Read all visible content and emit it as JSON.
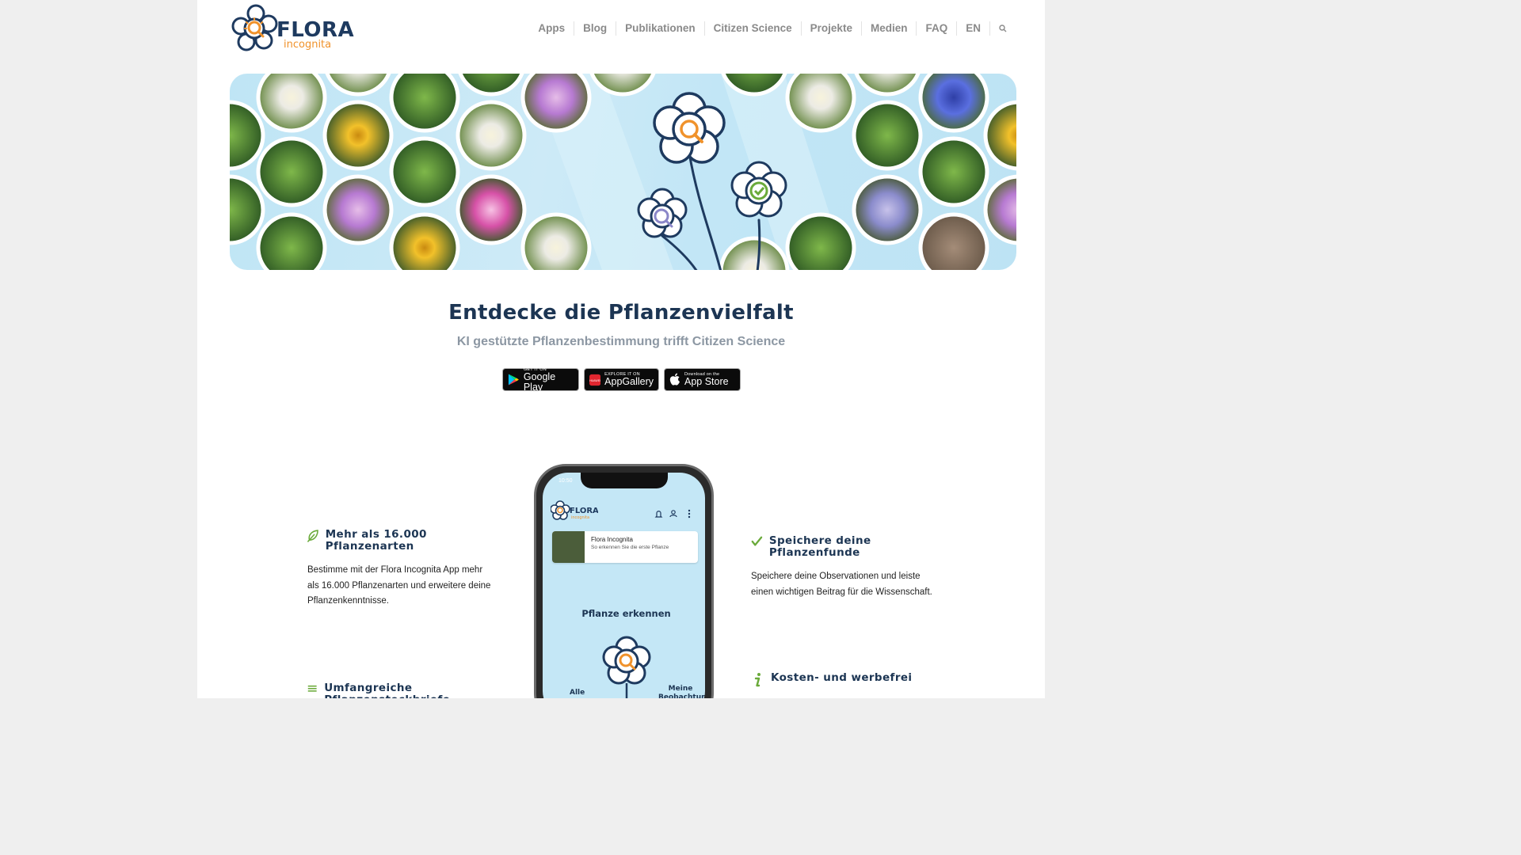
{
  "brand": {
    "name": "FLORA",
    "tagline": "incognita"
  },
  "nav": {
    "items": [
      "Apps",
      "Blog",
      "Publikationen",
      "Citizen Science",
      "Projekte",
      "Medien",
      "FAQ",
      "EN"
    ],
    "search_icon": "search-icon"
  },
  "hero": {
    "image": "flower-collage-banner"
  },
  "intro": {
    "title": "Entdecke die Pflanzenvielfalt",
    "subtitle": "KI gestützte Pflanzenbestimmung trifft Citizen Science"
  },
  "stores": [
    {
      "small": "GET IT ON",
      "big": "Google Play",
      "icon": "google-play-icon"
    },
    {
      "small": "EXPLORE IT ON",
      "big": "AppGallery",
      "icon": "huawei-icon"
    },
    {
      "small": "Download on the",
      "big": "App Store",
      "icon": "apple-icon"
    }
  ],
  "features": {
    "species": {
      "title": "Mehr als 16.000 Pflanzenarten",
      "text": "Bestimme mit der Flora Incognita App mehr als 16.000 Pflanzenarten und erweitere deine Pflanzenkenntnisse.",
      "icon": "leaf-icon"
    },
    "save": {
      "title": "Speichere deine Pflanzenfunde",
      "text": "Speichere deine Observationen und leiste einen wichtigen Beitrag für die Wissenschaft.",
      "icon": "checkmark-icon"
    },
    "profiles": {
      "title": "Umfangreiche Pflanzensteckbriefe",
      "icon": "list-icon"
    },
    "free": {
      "title": "Kosten- und werbefrei",
      "icon": "info-icon"
    }
  },
  "phone": {
    "time": "10:50",
    "card_title": "Flora Incognita",
    "card_subtitle": "So erkennen Sie die erste Pflanze",
    "cta": "Pflanze erkennen",
    "left_label": "Alle",
    "right_label": "Meine Beobachtungen"
  },
  "colors": {
    "navy": "#1c3553",
    "orange": "#f0922b",
    "green": "#6aaa3a",
    "sky": "#c4e7f6"
  }
}
